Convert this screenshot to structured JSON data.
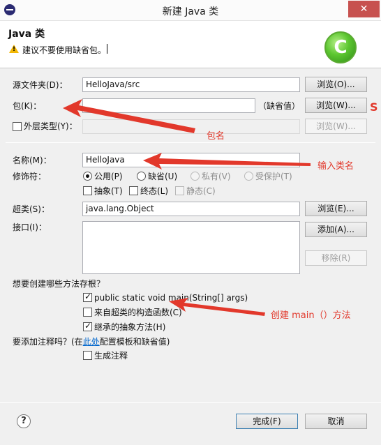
{
  "window": {
    "title": "新建 Java 类",
    "close": "✕"
  },
  "header": {
    "title": "Java 类",
    "message": "建议不要使用缺省包。",
    "logo_letter": "C"
  },
  "form": {
    "source_folder": {
      "label": "源文件夹(D)：",
      "value": "HelloJava/src",
      "browse": "浏览(O)..."
    },
    "package": {
      "label": "包(K)：",
      "value": "",
      "suffix": "（缺省值）",
      "browse": "浏览(W)..."
    },
    "enclosing": {
      "label": "外层类型(Y)：",
      "value": "",
      "browse": "浏览(W)..."
    },
    "name": {
      "label": "名称(M)：",
      "value": "HelloJava"
    },
    "modifiers": {
      "label": "修饰符：",
      "public": "公用(P)",
      "default": "缺省(U)",
      "private": "私有(V)",
      "protected": "受保护(T)",
      "abstract": "抽象(T)",
      "final": "终态(L)",
      "static": "静态(C)"
    },
    "superclass": {
      "label": "超类(S)：",
      "value": "java.lang.Object",
      "browse": "浏览(E)..."
    },
    "interfaces": {
      "label": "接口(I)：",
      "add": "添加(A)...",
      "remove": "移除(R)"
    },
    "stubs": {
      "question": "想要创建哪些方法存根？",
      "main": "public static void main(String[] args)",
      "constructors": "来自超类的构造函数(C)",
      "inherited": "继承的抽象方法(H)"
    },
    "comments": {
      "question_prefix": "要添加注释吗？(在",
      "link": "此处",
      "question_suffix": "配置模板和缺省值)",
      "generate": "生成注释"
    }
  },
  "footer": {
    "help": "?",
    "finish": "完成(F)",
    "cancel": "取消"
  },
  "annotations": {
    "package_name": "包名",
    "input_class_name": "输入类名",
    "create_main": "创建 main（）方法",
    "side_mark": "S"
  },
  "colors": {
    "annotation_red": "#e2382b",
    "logo_green": "#5cc630",
    "warning": "#f2b705"
  }
}
